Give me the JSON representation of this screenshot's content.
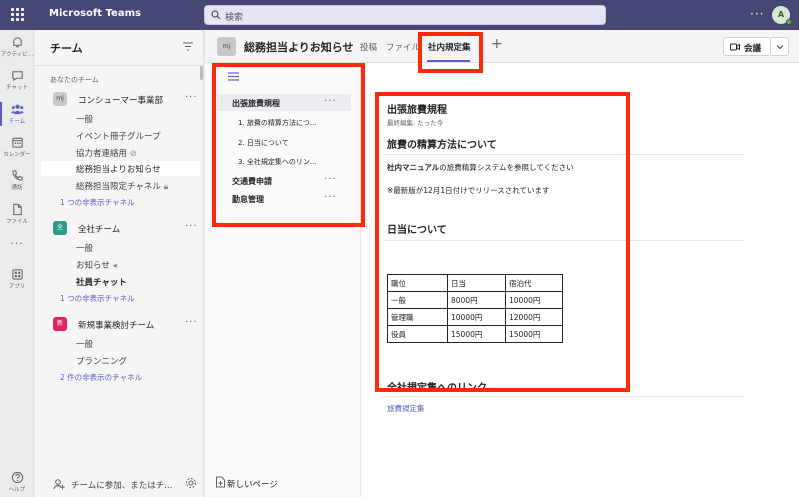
{
  "topbar": {
    "app_title": "Microsoft Teams",
    "search_placeholder": "検索",
    "more": "···",
    "avatar_initial": "A"
  },
  "rail": {
    "items": [
      {
        "label": "アクティビ...",
        "icon": "bell-icon"
      },
      {
        "label": "チャット",
        "icon": "chat-icon"
      },
      {
        "label": "チーム",
        "icon": "teams-icon"
      },
      {
        "label": "カレンダー",
        "icon": "calendar-icon"
      },
      {
        "label": "通話",
        "icon": "phone-icon"
      },
      {
        "label": "ファイル",
        "icon": "file-icon"
      },
      {
        "label": "···",
        "icon": "more-icon"
      },
      {
        "label": "アプリ",
        "icon": "apps-icon"
      },
      {
        "label": "ヘルプ",
        "icon": "help-icon"
      }
    ]
  },
  "teams_pane": {
    "title": "チーム",
    "section_label": "あなたのチーム",
    "teams": [
      {
        "name": "コンシューマー事業部",
        "avatar": "mj",
        "color": "#c8c8c8",
        "channels": [
          "一般",
          "イベント冊子グループ",
          "協力者連絡用",
          "総務担当よりお知らせ",
          "総務担当限定チャネル",
          "1 つの非表示チャネル"
        ]
      },
      {
        "name": "全社チーム",
        "avatar": "全",
        "color": "#2a9d8f",
        "channels": [
          "一般",
          "お知らせ",
          "社員チャット",
          "1 つの非表示チャネル"
        ]
      },
      {
        "name": "新規事業検討チーム",
        "avatar": "新",
        "color": "#e0245e",
        "channels": [
          "一般",
          "プランニング",
          "2 件の非表示のチャネル"
        ]
      }
    ],
    "join_text": "チームに参加、またはチ..."
  },
  "channel_header": {
    "avatar": "mj",
    "name": "総務担当よりお知らせ",
    "tabs": [
      "投稿",
      "ファイル",
      "社内規定集"
    ],
    "add_tab": "+",
    "meet_label": "会議"
  },
  "wiki_nav": {
    "sections": [
      {
        "label": "出張旅費規程",
        "more": "···"
      },
      {
        "label": "交通費申請",
        "more": "···"
      },
      {
        "label": "勤怠管理",
        "more": "···"
      }
    ],
    "subsections": [
      "1. 旅費の精算方法につ...",
      "2. 日当について",
      "3. 全社規定集へのリン..."
    ],
    "new_page": "新しいページ"
  },
  "wiki_content": {
    "title": "出張旅費規程",
    "last_edit": "最終編集: たった今",
    "section1_heading": "旅費の精算方法について",
    "para1_bold": "社内マニュアル",
    "para1_rest": "の旅費精算システムを参照してください",
    "para2": "※最新版が12月1日付けでリリースされています",
    "section2_heading": "日当について",
    "table": {
      "headers": [
        "職位",
        "日当",
        "宿泊代"
      ],
      "rows": [
        [
          "一般",
          "8000円",
          "10000円"
        ],
        [
          "管理職",
          "10000円",
          "12000円"
        ],
        [
          "役員",
          "15000円",
          "15000円"
        ]
      ]
    },
    "section3_heading": "全社規定集へのリンク",
    "link_text": "旅費規定集"
  },
  "highlight_color": "#ff2a0d",
  "accent_color": "#5b5fc7"
}
